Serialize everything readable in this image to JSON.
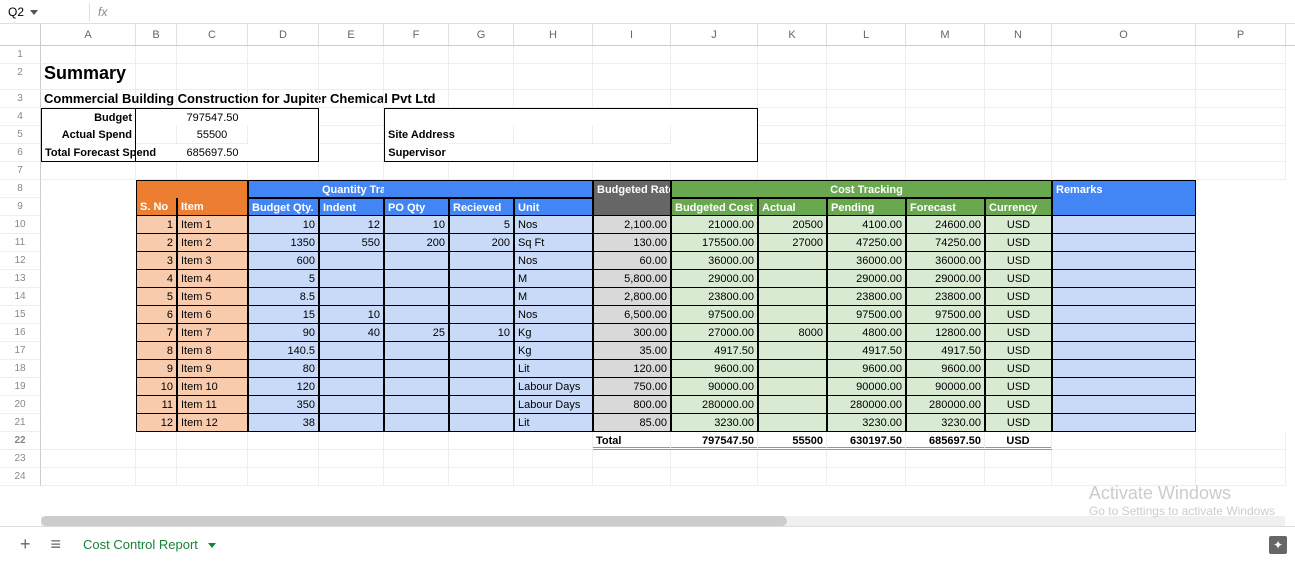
{
  "namebox": "Q2",
  "fx": "fx",
  "cols": [
    "A",
    "B",
    "C",
    "D",
    "E",
    "F",
    "G",
    "H",
    "I",
    "J",
    "K",
    "L",
    "M",
    "N",
    "O",
    "P"
  ],
  "summary": {
    "title": "Summary",
    "subtitle": "Commercial Building Construction for Jupiter Chemical Pvt Ltd",
    "budget_lbl": "Budget",
    "budget": "797547.50",
    "actual_lbl": "Actual Spend",
    "actual": "55500",
    "forecast_lbl": "Total Forecast Spend",
    "forecast": "685697.50",
    "site_lbl": "Site Address",
    "supervisor_lbl": "Supervisor"
  },
  "hdrs": {
    "sno": "S. No",
    "item": "Item",
    "qty": "Quantity Tracking",
    "bqty": "Budget Qty.",
    "indent": "Indent",
    "poqty": "PO Qty",
    "recv": "Recieved",
    "unit": "Unit",
    "brate": "Budgeted Rate",
    "cost": "Cost Tracking",
    "bcost": "Budgeted Cost",
    "act": "Actual",
    "pend": "Pending",
    "fcst": "Forecast",
    "curr": "Currency",
    "rem": "Remarks"
  },
  "rows": [
    {
      "n": "1",
      "item": "Item 1",
      "bq": "10",
      "ind": "12",
      "po": "10",
      "rc": "5",
      "u": "Nos",
      "br": "2,100.00",
      "bc": "21000.00",
      "ac": "20500",
      "pe": "4100.00",
      "fc": "24600.00",
      "cu": "USD"
    },
    {
      "n": "2",
      "item": "Item 2",
      "bq": "1350",
      "ind": "550",
      "po": "200",
      "rc": "200",
      "u": "Sq Ft",
      "br": "130.00",
      "bc": "175500.00",
      "ac": "27000",
      "pe": "47250.00",
      "fc": "74250.00",
      "cu": "USD"
    },
    {
      "n": "3",
      "item": "Item 3",
      "bq": "600",
      "ind": "",
      "po": "",
      "rc": "",
      "u": "Nos",
      "br": "60.00",
      "bc": "36000.00",
      "ac": "",
      "pe": "36000.00",
      "fc": "36000.00",
      "cu": "USD"
    },
    {
      "n": "4",
      "item": "Item 4",
      "bq": "5",
      "ind": "",
      "po": "",
      "rc": "",
      "u": "M",
      "br": "5,800.00",
      "bc": "29000.00",
      "ac": "",
      "pe": "29000.00",
      "fc": "29000.00",
      "cu": "USD"
    },
    {
      "n": "5",
      "item": "Item 5",
      "bq": "8.5",
      "ind": "",
      "po": "",
      "rc": "",
      "u": "M",
      "br": "2,800.00",
      "bc": "23800.00",
      "ac": "",
      "pe": "23800.00",
      "fc": "23800.00",
      "cu": "USD"
    },
    {
      "n": "6",
      "item": "Item 6",
      "bq": "15",
      "ind": "10",
      "po": "",
      "rc": "",
      "u": "Nos",
      "br": "6,500.00",
      "bc": "97500.00",
      "ac": "",
      "pe": "97500.00",
      "fc": "97500.00",
      "cu": "USD"
    },
    {
      "n": "7",
      "item": "Item 7",
      "bq": "90",
      "ind": "40",
      "po": "25",
      "rc": "10",
      "u": "Kg",
      "br": "300.00",
      "bc": "27000.00",
      "ac": "8000",
      "pe": "4800.00",
      "fc": "12800.00",
      "cu": "USD"
    },
    {
      "n": "8",
      "item": "Item 8",
      "bq": "140.5",
      "ind": "",
      "po": "",
      "rc": "",
      "u": "Kg",
      "br": "35.00",
      "bc": "4917.50",
      "ac": "",
      "pe": "4917.50",
      "fc": "4917.50",
      "cu": "USD"
    },
    {
      "n": "9",
      "item": "Item 9",
      "bq": "80",
      "ind": "",
      "po": "",
      "rc": "",
      "u": "Lit",
      "br": "120.00",
      "bc": "9600.00",
      "ac": "",
      "pe": "9600.00",
      "fc": "9600.00",
      "cu": "USD"
    },
    {
      "n": "10",
      "item": "Item 10",
      "bq": "120",
      "ind": "",
      "po": "",
      "rc": "",
      "u": "Labour Days",
      "br": "750.00",
      "bc": "90000.00",
      "ac": "",
      "pe": "90000.00",
      "fc": "90000.00",
      "cu": "USD"
    },
    {
      "n": "11",
      "item": "Item 11",
      "bq": "350",
      "ind": "",
      "po": "",
      "rc": "",
      "u": "Labour Days",
      "br": "800.00",
      "bc": "280000.00",
      "ac": "",
      "pe": "280000.00",
      "fc": "280000.00",
      "cu": "USD"
    },
    {
      "n": "12",
      "item": "Item 12",
      "bq": "38",
      "ind": "",
      "po": "",
      "rc": "",
      "u": "Lit",
      "br": "85.00",
      "bc": "3230.00",
      "ac": "",
      "pe": "3230.00",
      "fc": "3230.00",
      "cu": "USD"
    }
  ],
  "totals": {
    "lbl": "Total",
    "bc": "797547.50",
    "ac": "55500",
    "pe": "630197.50",
    "fc": "685697.50",
    "cu": "USD"
  },
  "sheet": "Cost Control Report",
  "watermark": {
    "w1": "Activate Windows",
    "w2": "Go to Settings to activate Windows"
  }
}
